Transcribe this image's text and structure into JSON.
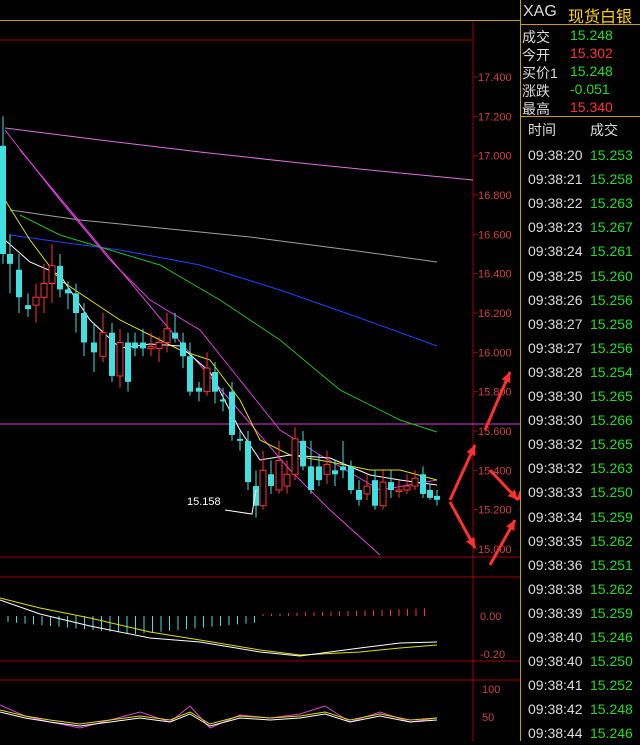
{
  "header": {
    "symbol": "XAG",
    "name": "现货白银"
  },
  "quote": [
    {
      "label": "成交",
      "value": "15.248",
      "color": "#22dd22"
    },
    {
      "label": "今开",
      "value": "15.302",
      "color": "#ff3232"
    },
    {
      "label": "买价1",
      "value": "15.248",
      "color": "#22dd22"
    },
    {
      "label": "涨跌",
      "value": "-0.051",
      "color": "#22dd22"
    },
    {
      "label": "最高",
      "value": "15.340",
      "color": "#ff3232"
    }
  ],
  "ticks_header": {
    "time": "时间",
    "price": "成交"
  },
  "ticks": [
    {
      "time": "09:38:20",
      "price": "15.253"
    },
    {
      "time": "09:38:21",
      "price": "15.258"
    },
    {
      "time": "09:38:22",
      "price": "15.263"
    },
    {
      "time": "09:38:23",
      "price": "15.267"
    },
    {
      "time": "09:38:24",
      "price": "15.261"
    },
    {
      "time": "09:38:25",
      "price": "15.260"
    },
    {
      "time": "09:38:26",
      "price": "15.256"
    },
    {
      "time": "09:38:27",
      "price": "15.258"
    },
    {
      "time": "09:38:27",
      "price": "15.256"
    },
    {
      "time": "09:38:28",
      "price": "15.254"
    },
    {
      "time": "09:38:30",
      "price": "15.265"
    },
    {
      "time": "09:38:30",
      "price": "15.266"
    },
    {
      "time": "09:38:32",
      "price": "15.265"
    },
    {
      "time": "09:38:32",
      "price": "15.263"
    },
    {
      "time": "09:38:33",
      "price": "15.250"
    },
    {
      "time": "09:38:34",
      "price": "15.259"
    },
    {
      "time": "09:38:35",
      "price": "15.262"
    },
    {
      "time": "09:38:36",
      "price": "15.251"
    },
    {
      "time": "09:38:38",
      "price": "15.262"
    },
    {
      "time": "09:38:39",
      "price": "15.259"
    },
    {
      "time": "09:38:40",
      "price": "15.246"
    },
    {
      "time": "09:38:40",
      "price": "15.250"
    },
    {
      "time": "09:38:41",
      "price": "15.252"
    },
    {
      "time": "09:38:42",
      "price": "15.248"
    },
    {
      "time": "09:38:44",
      "price": "15.246"
    }
  ],
  "main_axis": [
    "17.400",
    "17.200",
    "17.000",
    "16.800",
    "16.600",
    "16.400",
    "16.200",
    "16.000",
    "15.800",
    "15.600",
    "15.400",
    "15.200",
    "15.000"
  ],
  "macd_axis": [
    "0.00",
    "-0.20"
  ],
  "kdj_axis": [
    "100",
    "50"
  ],
  "low_annotation": "15.158",
  "colors": {
    "up": "#ff3232",
    "down": "#40e0e0",
    "ma_short": "#ffffff",
    "ma_yellow": "#e0e000",
    "ma_magenta": "#e040e0",
    "ma_green": "#20c020",
    "ma_blue": "#2040ff",
    "ma_gray": "#a0a0a0",
    "ma_pink": "#e070e0",
    "arrow": "#ff3030"
  }
}
